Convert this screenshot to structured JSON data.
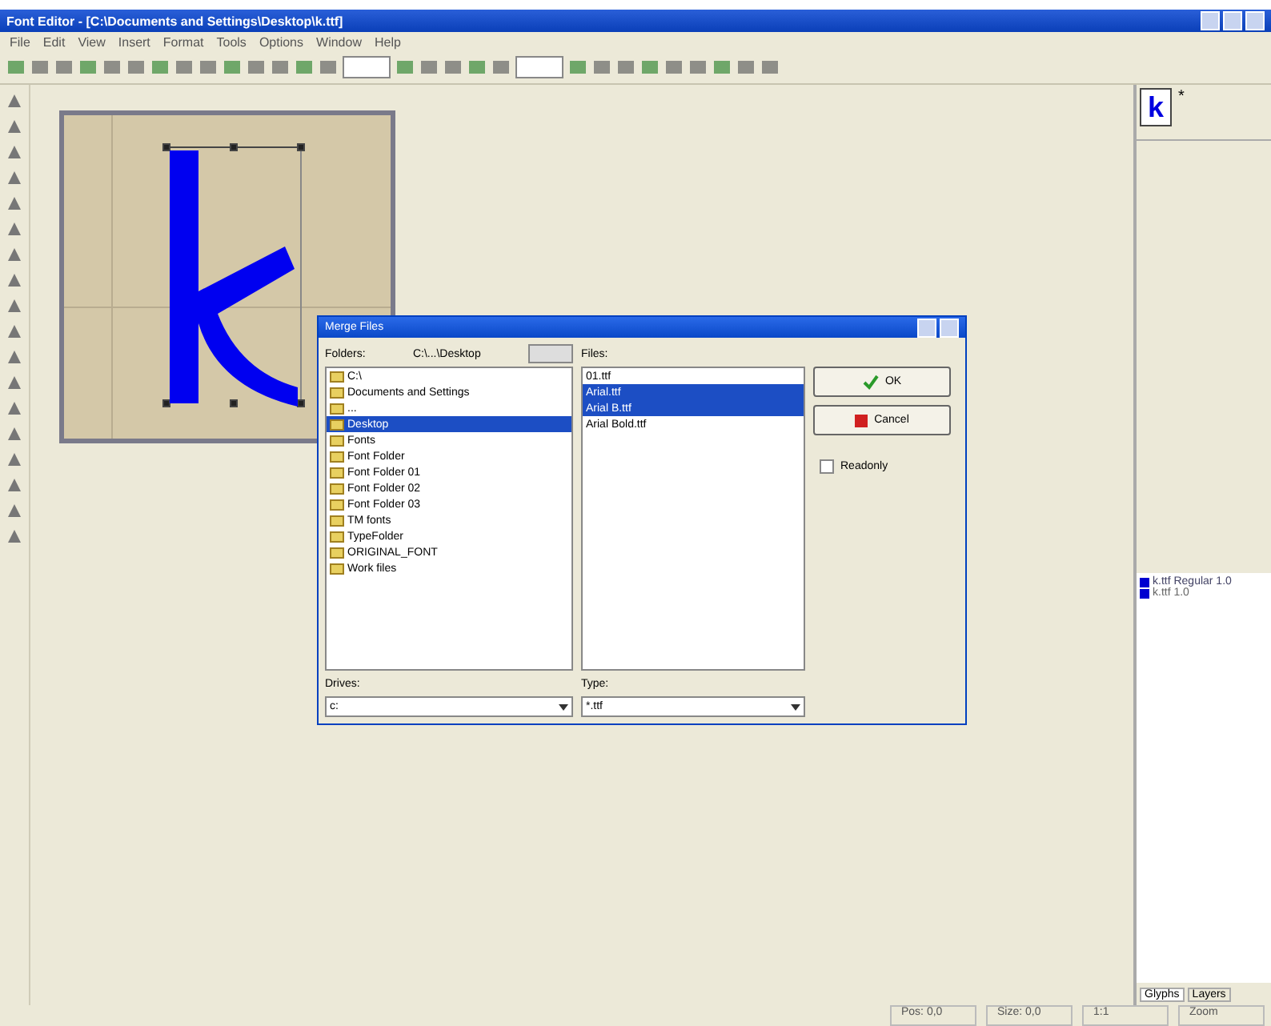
{
  "window": {
    "title": "Font Editor - [C:\\Documents and Settings\\Desktop\\k.ttf]"
  },
  "menu": [
    "File",
    "Edit",
    "View",
    "Insert",
    "Format",
    "Tools",
    "Options",
    "Window",
    "Help"
  ],
  "glyph_panel": {
    "glyph": "k",
    "marker": "*"
  },
  "glyph_list": [
    {
      "label": "k.ttf  Regular 1.0",
      "selected": true
    },
    {
      "label": "k.ttf  1.0",
      "selected": false
    }
  ],
  "panel_tabs": [
    {
      "label": "Glyphs",
      "selected": true
    },
    {
      "label": "Layers",
      "selected": false
    }
  ],
  "status_bar": [
    "Pos: 0,0",
    "Size: 0,0",
    "1:1",
    "Zoom"
  ],
  "dialog": {
    "title": "Merge Files",
    "folders_label": "Folders:",
    "path": "C:\\...\\Desktop",
    "folders": [
      {
        "label": "C:\\",
        "selected": false
      },
      {
        "label": "Documents and Settings",
        "selected": false
      },
      {
        "label": "...",
        "selected": false
      },
      {
        "label": "Desktop",
        "selected": true
      },
      {
        "label": "Fonts",
        "selected": false
      },
      {
        "label": "Font Folder",
        "selected": false
      },
      {
        "label": "Font Folder 01",
        "selected": false
      },
      {
        "label": "Font Folder 02",
        "selected": false
      },
      {
        "label": "Font Folder 03",
        "selected": false
      },
      {
        "label": "TM fonts",
        "selected": false
      },
      {
        "label": "TypeFolder",
        "selected": false
      },
      {
        "label": "ORIGINAL_FONT",
        "selected": false
      },
      {
        "label": "Work files",
        "selected": false
      }
    ],
    "files_label": "Files:",
    "files": [
      {
        "label": "01.ttf",
        "selected": false
      },
      {
        "label": "Arial.ttf",
        "selected": true
      },
      {
        "label": "Arial B.ttf",
        "selected": true
      },
      {
        "label": "Arial Bold.ttf",
        "selected": false
      }
    ],
    "ok": "OK",
    "cancel": "Cancel",
    "readonly": {
      "label": "Readonly",
      "checked": false
    },
    "drives_label": "Drives:",
    "drive": "c:",
    "type_label": "Type:",
    "type": "*.ttf"
  }
}
